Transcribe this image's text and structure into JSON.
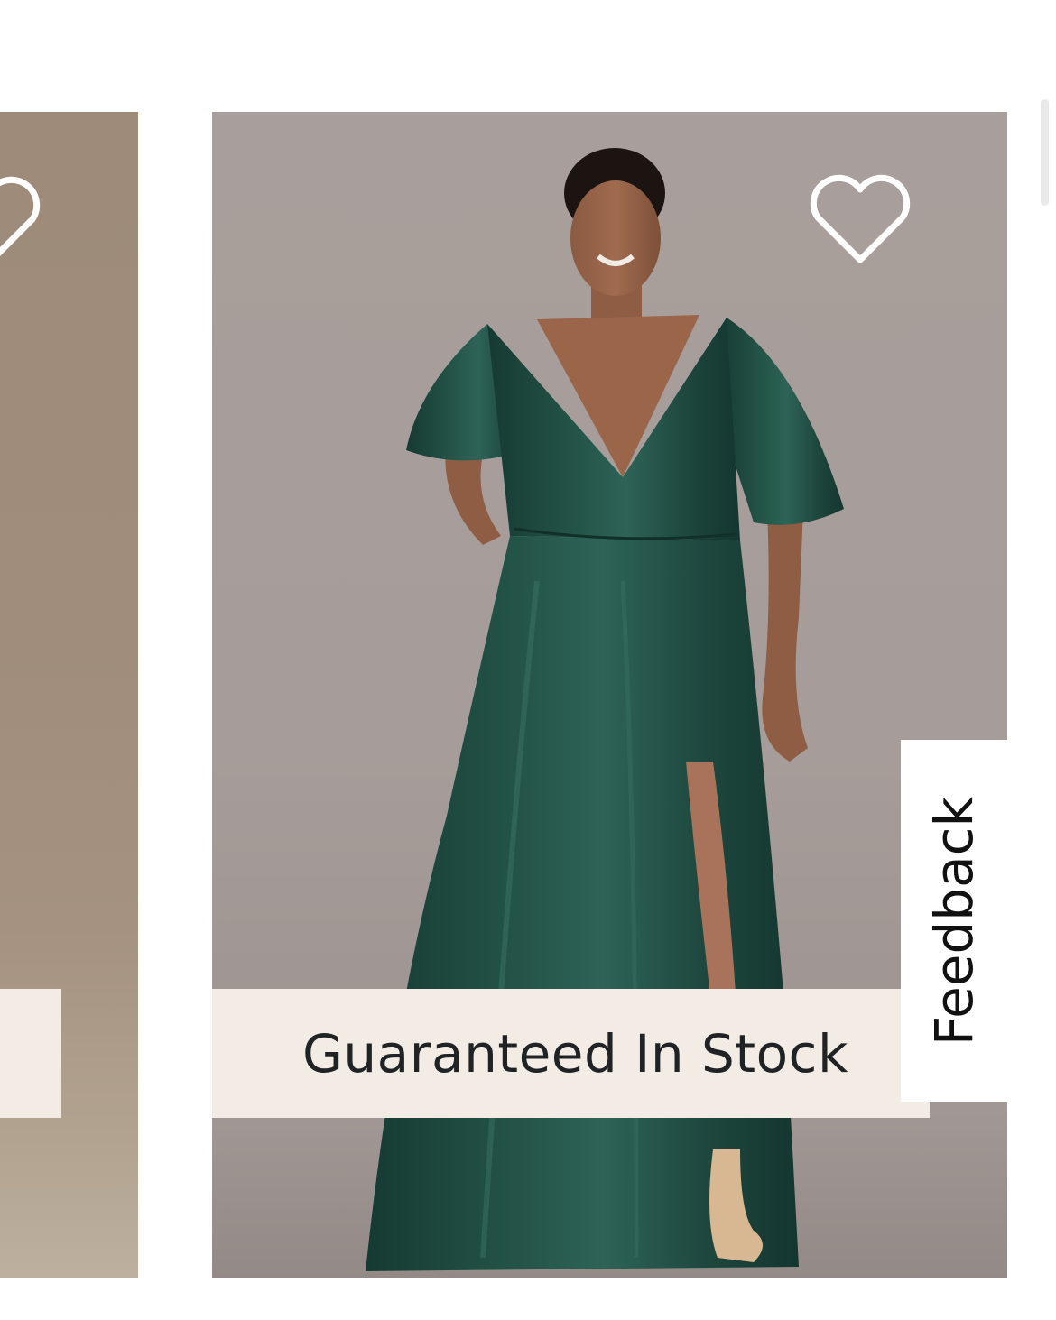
{
  "products": {
    "previous_card": {
      "favorite_icon": "heart-outline-icon"
    },
    "current_card": {
      "favorite_icon": "heart-outline-icon",
      "image_alt": "Model wearing an emerald green satin flutter-sleeve V-neck maxi dress with side slit",
      "badge_label": "Guaranteed In Stock"
    }
  },
  "feedback": {
    "label": "Feedback"
  },
  "colors": {
    "badge_background": "#f3ece4",
    "dress_green": "#1f4a40",
    "backdrop": "#a89e9b"
  }
}
